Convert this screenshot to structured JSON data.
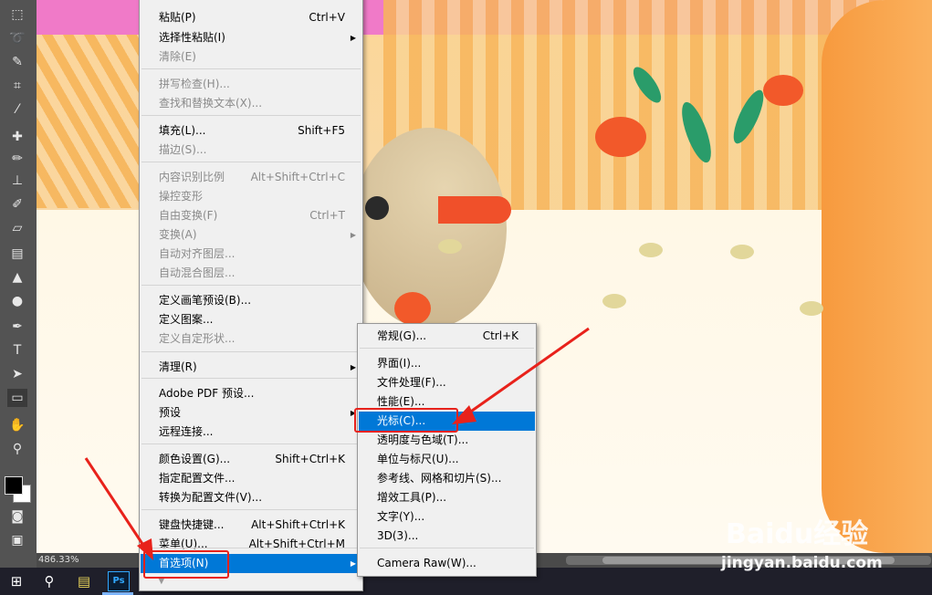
{
  "edit_menu": {
    "items": [
      {
        "label": "粘贴(P)",
        "shortcut": "Ctrl+V",
        "disabled": false
      },
      {
        "label": "选择性粘贴(I)",
        "submenu": true,
        "disabled": false
      },
      {
        "label": "清除(E)",
        "disabled": true
      },
      {
        "label": "拼写检查(H)...",
        "disabled": true
      },
      {
        "label": "查找和替换文本(X)...",
        "disabled": true
      },
      {
        "label": "填充(L)...",
        "shortcut": "Shift+F5",
        "disabled": false
      },
      {
        "label": "描边(S)...",
        "disabled": true
      },
      {
        "label": "内容识别比例",
        "shortcut": "Alt+Shift+Ctrl+C",
        "disabled": true
      },
      {
        "label": "操控变形",
        "disabled": true
      },
      {
        "label": "自由变换(F)",
        "shortcut": "Ctrl+T",
        "disabled": true
      },
      {
        "label": "变换(A)",
        "submenu": true,
        "disabled": true
      },
      {
        "label": "自动对齐图层...",
        "disabled": true
      },
      {
        "label": "自动混合图层...",
        "disabled": true
      },
      {
        "label": "定义画笔预设(B)...",
        "disabled": false
      },
      {
        "label": "定义图案...",
        "disabled": false
      },
      {
        "label": "定义自定形状...",
        "disabled": true
      },
      {
        "label": "清理(R)",
        "submenu": true,
        "disabled": false
      },
      {
        "label": "Adobe PDF 预设...",
        "disabled": false
      },
      {
        "label": "预设",
        "submenu": true,
        "disabled": false
      },
      {
        "label": "远程连接...",
        "disabled": false
      },
      {
        "label": "颜色设置(G)...",
        "shortcut": "Shift+Ctrl+K",
        "disabled": false
      },
      {
        "label": "指定配置文件...",
        "disabled": false
      },
      {
        "label": "转换为配置文件(V)...",
        "disabled": false
      },
      {
        "label": "键盘快捷键...",
        "shortcut": "Alt+Shift+Ctrl+K",
        "disabled": false
      },
      {
        "label": "菜单(U)...",
        "shortcut": "Alt+Shift+Ctrl+M",
        "disabled": false
      },
      {
        "label": "首选项(N)",
        "submenu": true,
        "selected": true,
        "disabled": false
      }
    ]
  },
  "pref_menu": {
    "items": [
      {
        "label": "常规(G)...",
        "shortcut": "Ctrl+K"
      },
      {
        "label": "界面(I)..."
      },
      {
        "label": "文件处理(F)..."
      },
      {
        "label": "性能(E)..."
      },
      {
        "label": "光标(C)...",
        "selected": true
      },
      {
        "label": "透明度与色域(T)..."
      },
      {
        "label": "单位与标尺(U)..."
      },
      {
        "label": "参考线、网格和切片(S)..."
      },
      {
        "label": "增效工具(P)..."
      },
      {
        "label": "文字(Y)..."
      },
      {
        "label": "3D(3)..."
      },
      {
        "label": "Camera Raw(W)..."
      }
    ]
  },
  "status": {
    "zoom": "486.33%"
  },
  "taskbar": {
    "ps_label": "Ps"
  },
  "watermark": {
    "main": "Baidu经验",
    "url": "jingyan.baidu.com"
  },
  "colors": {
    "highlight": "#0078d7",
    "annotation": "#e8221b"
  }
}
